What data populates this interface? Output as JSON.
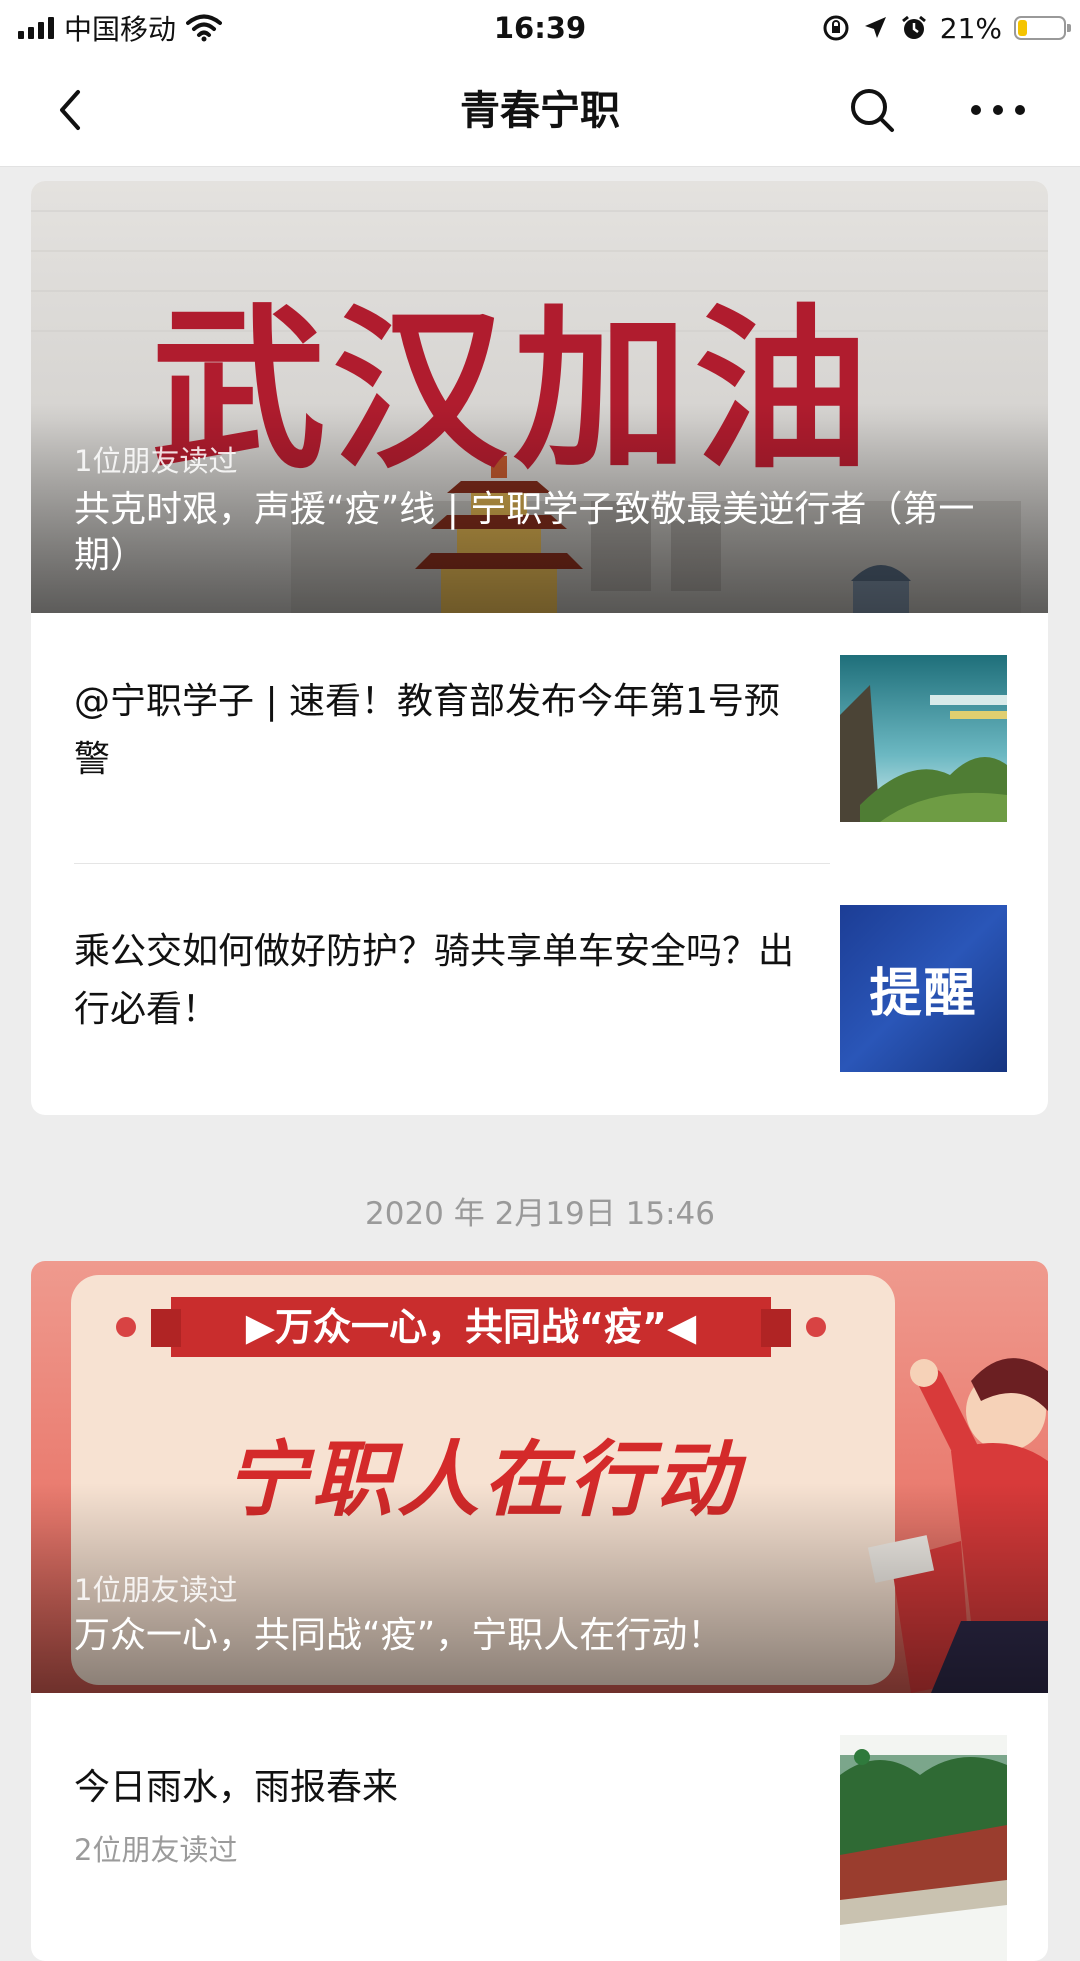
{
  "status_bar": {
    "carrier": "中国移动",
    "time": "16:39",
    "battery_percent": "21%",
    "battery_level": 0.21,
    "icons": [
      "signal-icon",
      "wifi-icon",
      "orientation-lock-icon",
      "location-icon",
      "alarm-icon",
      "battery-icon"
    ]
  },
  "nav": {
    "title": "青春宁职",
    "icons": [
      "back-chevron-icon",
      "search-icon",
      "more-dots-icon"
    ]
  },
  "group1": {
    "hero": {
      "banner_text": "武汉加油",
      "readers": "1位朋友读过",
      "title": "共克时艰，声援“疫”线 | 宁职学子致敬最美逆行者（第一期）"
    },
    "items": [
      {
        "title": "@宁职学子 | 速看！教育部发布今年第1号预警"
      },
      {
        "title": "乘公交如何做好防护？骑共享单车安全吗？出行必看！",
        "thumb_text": "提醒"
      }
    ]
  },
  "date_label": "2020 年 2月19日 15:46",
  "group2": {
    "hero": {
      "ribbon_text": "▶万众一心，共同战“疫”◀",
      "banner_text": "宁职人在行动",
      "readers": "1位朋友读过",
      "title": "万众一心，共同战“疫”，宁职人在行动！"
    },
    "items": [
      {
        "title": "今日雨水，雨报春来",
        "readers": "2位朋友读过"
      }
    ]
  },
  "colors": {
    "accent_red": "#b01c2e",
    "battery_yellow": "#f5c400",
    "page_bg": "#ededed"
  }
}
